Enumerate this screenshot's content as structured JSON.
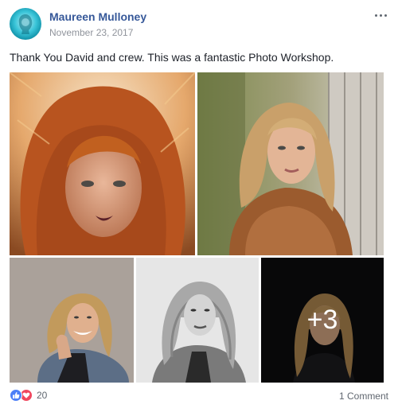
{
  "post": {
    "author": "Maureen Mulloney",
    "date": "November 23, 2017",
    "message": "Thank You David and crew. This was a fantastic Photo Workshop.",
    "more_overlay": "+3",
    "reaction_count": "20",
    "comments_label": "1 Comment"
  },
  "icons": {
    "avatar": "avatar-image",
    "options": "more-options-icon",
    "like": "like-icon",
    "love": "love-icon"
  },
  "colors": {
    "author_link": "#365899",
    "secondary_text": "#90949c",
    "like_blue": "#4d7ff7",
    "love_red": "#f0465e"
  }
}
